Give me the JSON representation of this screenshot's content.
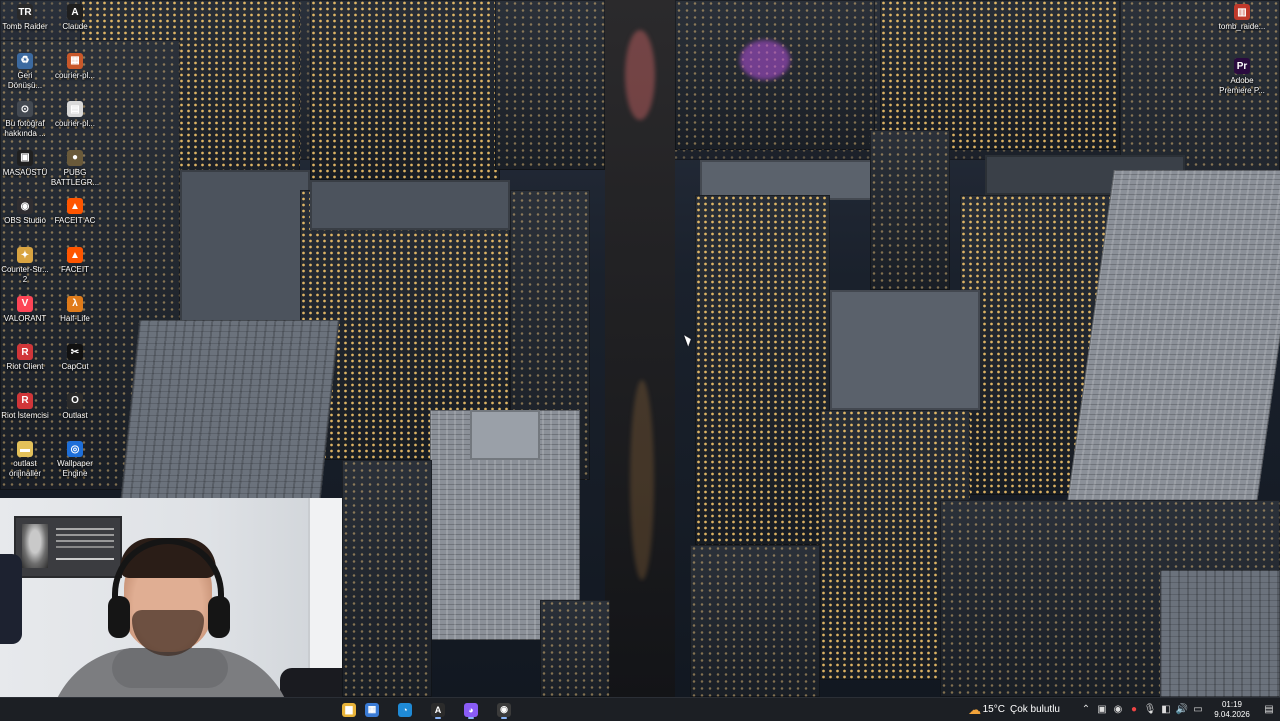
{
  "desktop": {
    "icons": [
      {
        "label": "Tomb Raider",
        "glyph": "TR",
        "color": "#2a2a2a"
      },
      {
        "label": "Claude",
        "glyph": "A",
        "color": "#1f1f1f"
      },
      {
        "label": "Geri Dönüşü...",
        "glyph": "♻",
        "color": "#3c6aa0"
      },
      {
        "label": "courier-pl...",
        "glyph": "▦",
        "color": "#c9582a"
      },
      {
        "label": "Bu fotoğraf hakkında ...",
        "glyph": "⊙",
        "color": "#444a52"
      },
      {
        "label": "courier-pl...",
        "glyph": "▤",
        "color": "#d9d9d9"
      },
      {
        "label": "MASAÜSTÜ",
        "glyph": "▣",
        "color": "#202020"
      },
      {
        "label": "PUBG BATTLEGR...",
        "glyph": "●",
        "color": "#6a5a3a"
      },
      {
        "label": "OBS Studio",
        "glyph": "◉",
        "color": "#302e31"
      },
      {
        "label": "FACEIT AC",
        "glyph": "▲",
        "color": "#ff5500"
      },
      {
        "label": "Counter-Str... 2",
        "glyph": "✦",
        "color": "#d9a441"
      },
      {
        "label": "FACEIT",
        "glyph": "▲",
        "color": "#ff5500"
      },
      {
        "label": "VALORANT",
        "glyph": "V",
        "color": "#fd4556"
      },
      {
        "label": "Half-Life",
        "glyph": "λ",
        "color": "#e07b1a"
      },
      {
        "label": "Riot Client",
        "glyph": "R",
        "color": "#d13639"
      },
      {
        "label": "CapCut",
        "glyph": "✂",
        "color": "#111111"
      },
      {
        "label": "Riot İstemcisi",
        "glyph": "R",
        "color": "#d13639"
      },
      {
        "label": "Outlast",
        "glyph": "O",
        "color": "#2b2b2b"
      },
      {
        "label": "outlast orijinaller",
        "glyph": "▬",
        "color": "#e3c15a"
      },
      {
        "label": "Wallpaper Engine",
        "glyph": "◎",
        "color": "#1e6fd9"
      }
    ],
    "right_icons": [
      {
        "label": "tomb_raide...",
        "glyph": "▥",
        "color": "#c0392b"
      },
      {
        "label": "Adobe Premiere P...",
        "glyph": "Pr",
        "color": "#2a0b3f"
      }
    ]
  },
  "taskbar": {
    "apps": [
      {
        "name": "file-explorer",
        "glyph": "▆",
        "color": "#e8b339"
      },
      {
        "name": "microsoft-store",
        "glyph": "▦",
        "color": "#3a7bd5"
      },
      {
        "name": "edge",
        "glyph": "◔",
        "color": "#1f8ad6"
      },
      {
        "name": "claude",
        "glyph": "A",
        "color": "#2b2b2b"
      },
      {
        "name": "discord",
        "glyph": "◕",
        "color": "#8a5cf6"
      },
      {
        "name": "obs",
        "glyph": "◉",
        "color": "#3b3b3b"
      }
    ],
    "weather": {
      "temp": "15°C",
      "text": "Çok bulutlu"
    },
    "clock": {
      "time": "01:19",
      "date": "9.04.2026"
    }
  },
  "webcam": {
    "label": "webcam-overlay"
  }
}
